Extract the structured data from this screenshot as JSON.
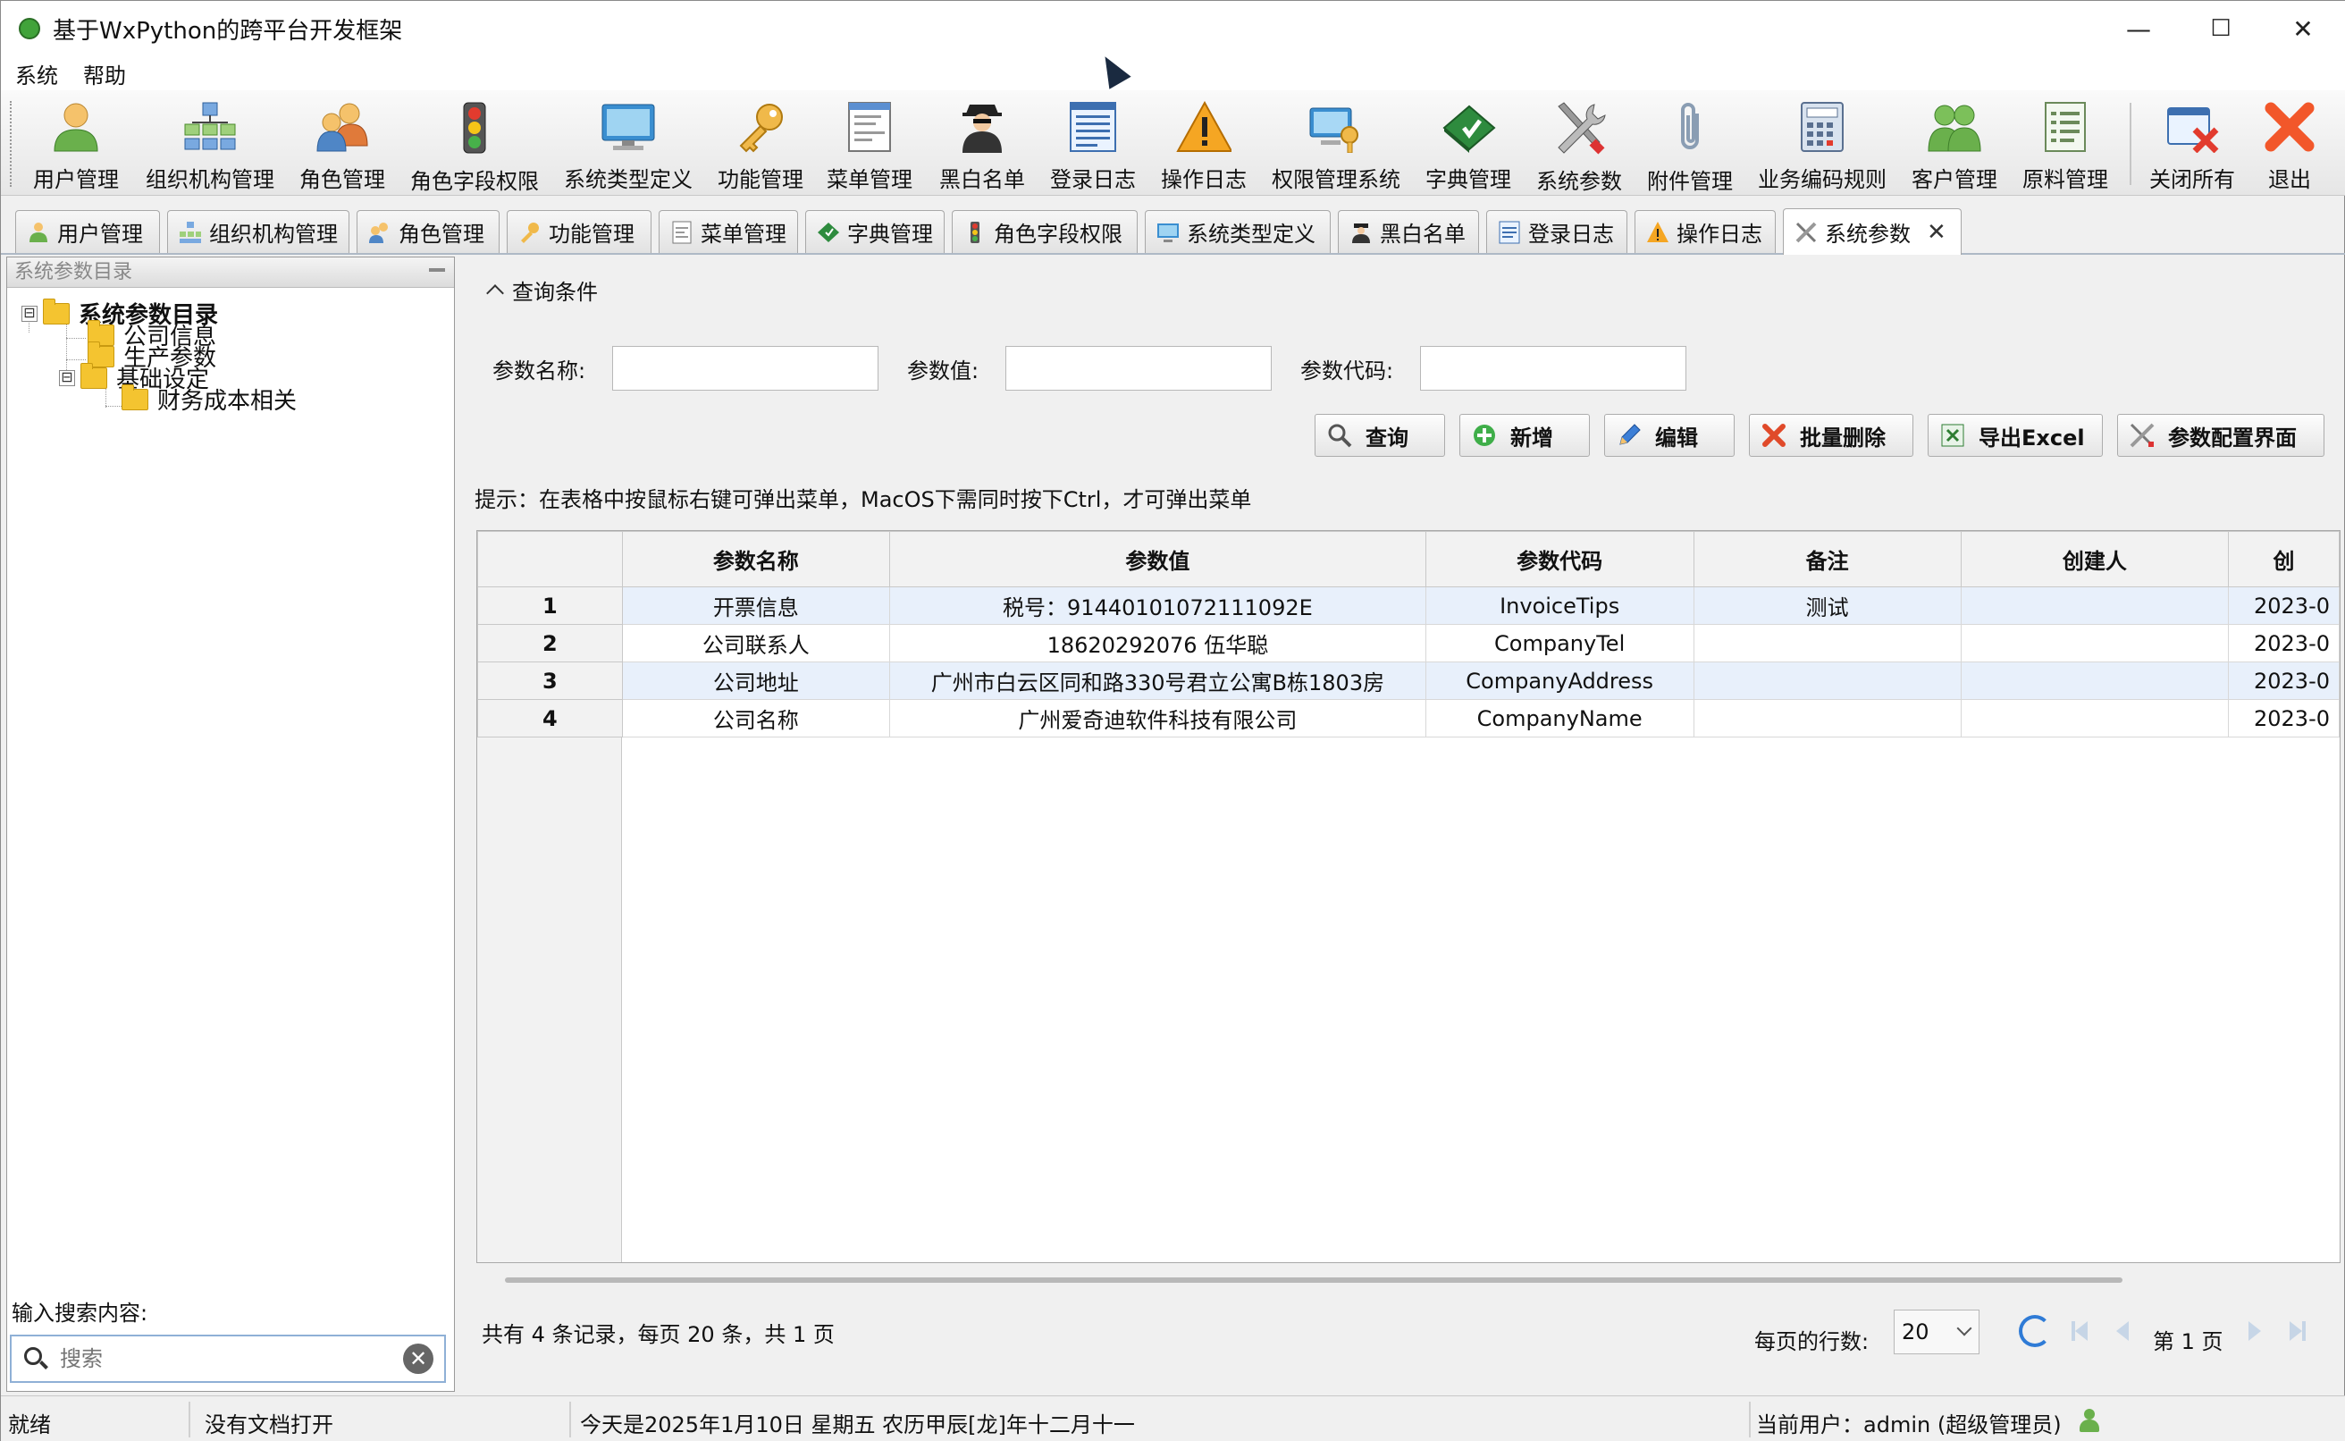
{
  "window": {
    "title": "基于WxPython的跨平台开发框架",
    "minimize": "—",
    "maximize": "☐",
    "close": "✕"
  },
  "menu": [
    "系统",
    "帮助"
  ],
  "toolbar": [
    {
      "label": "用户管理",
      "icon": "user-icon"
    },
    {
      "label": "组织机构管理",
      "icon": "org-chart-icon"
    },
    {
      "label": "角色管理",
      "icon": "role-icon"
    },
    {
      "label": "角色字段权限",
      "icon": "traffic-light-icon"
    },
    {
      "label": "系统类型定义",
      "icon": "monitor-icon"
    },
    {
      "label": "功能管理",
      "icon": "key-icon"
    },
    {
      "label": "菜单管理",
      "icon": "menu-doc-icon"
    },
    {
      "label": "黑白名单",
      "icon": "spy-icon"
    },
    {
      "label": "登录日志",
      "icon": "log-doc-icon"
    },
    {
      "label": "操作日志",
      "icon": "warning-icon"
    },
    {
      "label": "权限管理系统",
      "icon": "permission-icon"
    },
    {
      "label": "字典管理",
      "icon": "dictionary-icon"
    },
    {
      "label": "系统参数",
      "icon": "tools-icon"
    },
    {
      "label": "附件管理",
      "icon": "paperclip-icon"
    },
    {
      "label": "业务编码规则",
      "icon": "calculator-icon"
    },
    {
      "label": "客户管理",
      "icon": "customers-icon"
    },
    {
      "label": "原料管理",
      "icon": "materials-icon"
    },
    {
      "label": "关闭所有",
      "icon": "close-all-icon"
    },
    {
      "label": "退出",
      "icon": "exit-icon"
    }
  ],
  "tabs": [
    "用户管理",
    "组织机构管理",
    "角色管理",
    "功能管理",
    "菜单管理",
    "字典管理",
    "角色字段权限",
    "系统类型定义",
    "黑白名单",
    "登录日志",
    "操作日志",
    "系统参数"
  ],
  "tab_close": "✕",
  "left_panel": {
    "header": "系统参数目录",
    "tree": [
      {
        "label": "系统参数目录",
        "level": 0,
        "expanded": true
      },
      {
        "label": "公司信息",
        "level": 1
      },
      {
        "label": "生产参数",
        "level": 1
      },
      {
        "label": "基础设定",
        "level": 1,
        "expanded": true
      },
      {
        "label": "财务成本相关",
        "level": 2
      }
    ],
    "expander_minus": "⊟",
    "search_label": "输入搜索内容:",
    "search_placeholder": "搜索",
    "search_clear": "✕"
  },
  "query": {
    "header": "查询条件",
    "fields": [
      {
        "label": "参数名称:",
        "value": ""
      },
      {
        "label": "参数值:",
        "value": ""
      },
      {
        "label": "参数代码:",
        "value": ""
      }
    ],
    "buttons": [
      "查询",
      "新增",
      "编辑",
      "批量删除",
      "导出Excel",
      "参数配置界面"
    ]
  },
  "hint": "提示：在表格中按鼠标右键可弹出菜单，MacOS下需同时按下Ctrl，才可弹出菜单",
  "table": {
    "columns": [
      "",
      "参数名称",
      "参数值",
      "参数代码",
      "备注",
      "创建人",
      "创"
    ],
    "rows": [
      [
        "1",
        "开票信息",
        "税号：91440101072111092E",
        "InvoiceTips",
        "测试",
        "",
        "2023-0"
      ],
      [
        "2",
        "公司联系人",
        "18620292076 伍华聪",
        "CompanyTel",
        "",
        "",
        "2023-0"
      ],
      [
        "3",
        "公司地址",
        "广州市白云区同和路330号君立公寓B栋1803房",
        "CompanyAddress",
        "",
        "",
        "2023-0"
      ],
      [
        "4",
        "公司名称",
        "广州爱奇迪软件科技有限公司",
        "CompanyName",
        "",
        "",
        "2023-0"
      ]
    ]
  },
  "pager": {
    "summary": "共有 4 条记录，每页 20 条，共 1 页",
    "per_page_label": "每页的行数:",
    "per_page": "20",
    "page_label": "第 1 页"
  },
  "status": {
    "ready": "就绪",
    "doc": "没有文档打开",
    "date": "今天是2025年1月10日 星期五 农历甲辰[龙]年十二月十一",
    "user": "当前用户：admin (超级管理员)"
  },
  "colors": {
    "accent": "#2f7bd6",
    "row_alt": "#e8f0fb",
    "warning": "#f5a623",
    "danger": "#e23b2e"
  }
}
